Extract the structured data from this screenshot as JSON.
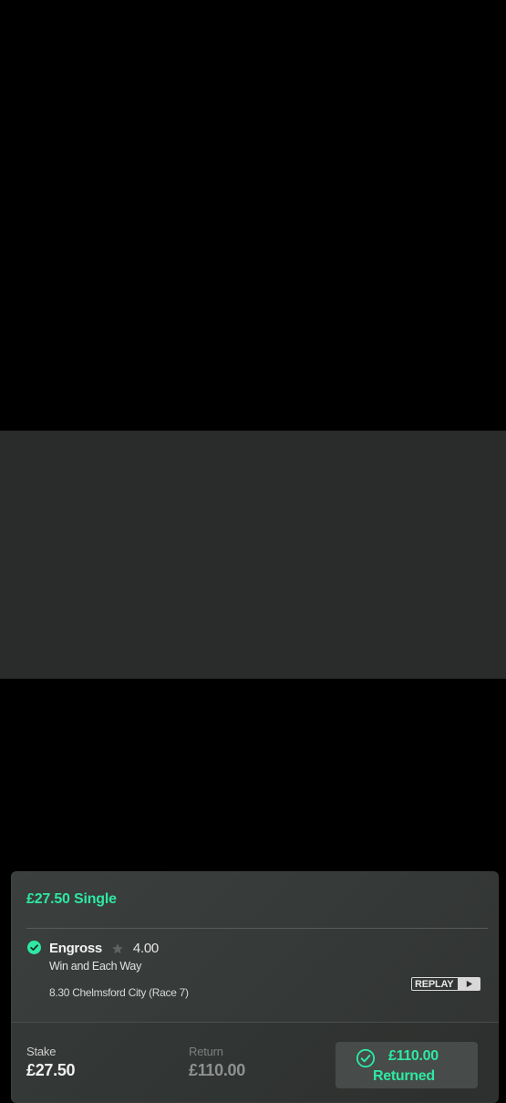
{
  "bet": {
    "title": "£27.50 Single",
    "selection": {
      "name": "Engross",
      "odds": "4.00",
      "market": "Win and Each Way",
      "event": "8.30 Chelmsford City (Race 7)",
      "status_icon": "check-circle-icon",
      "favourite_icon": "star-icon"
    },
    "replay_label": "REPLAY",
    "stake": {
      "label": "Stake",
      "value": "£27.50"
    },
    "return": {
      "label": "Return",
      "value": "£110.00"
    },
    "returned": {
      "amount": "£110.00",
      "text": "Returned",
      "icon": "check-circle-icon"
    }
  },
  "colors": {
    "accent": "#2ee8a4",
    "card_background": "#383c3a",
    "page_background": "#000000"
  }
}
